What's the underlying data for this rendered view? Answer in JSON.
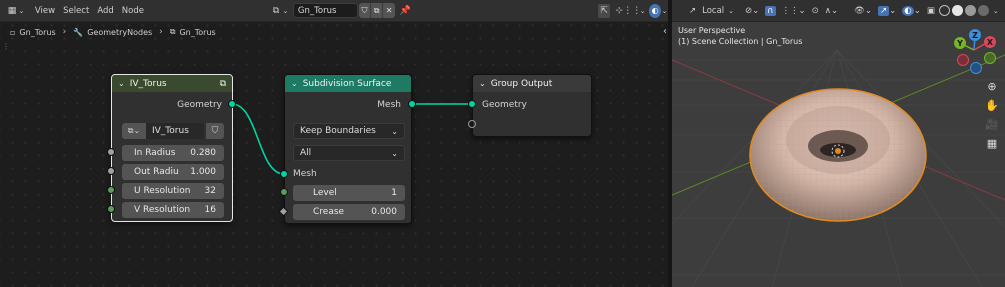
{
  "editor_header": {
    "menu": [
      "View",
      "Select",
      "Add",
      "Node"
    ],
    "node_group_name": "Gn_Torus"
  },
  "breadcrumb": [
    "Gn_Torus",
    "GeometryNodes",
    "Gn_Torus"
  ],
  "nodes": {
    "torus": {
      "title": "IV_Torus",
      "output_label": "Geometry",
      "group_name": "IV_Torus",
      "fields": [
        {
          "label": "In Radius",
          "value": "0.280"
        },
        {
          "label": "Out Radiu",
          "value": "1.000"
        },
        {
          "label": "U Resolution",
          "value": "32"
        },
        {
          "label": "V Resolution",
          "value": "16"
        }
      ],
      "header_color": "#3a4a2e"
    },
    "subdivision": {
      "title": "Subdivision Surface",
      "output_label": "Mesh",
      "dropdown1": "Keep Boundaries",
      "dropdown2": "All",
      "input_label": "Mesh",
      "level_label": "Level",
      "level_value": "1",
      "crease_label": "Crease",
      "crease_value": "0.000",
      "header_color": "#1f7a63"
    },
    "output": {
      "title": "Group Output",
      "input_label": "Geometry",
      "header_color": "#3a3a3a"
    }
  },
  "viewport": {
    "orientation": "Local",
    "info_line1": "User Perspective",
    "info_line2": "(1) Scene Collection | Gn_Torus",
    "gizmo": {
      "z": "Z",
      "y": "Y",
      "x": "X"
    }
  },
  "colors": {
    "geometry_socket": "#00d6a3",
    "selection_outline": "#e38a1e",
    "x_axis": "#d8485a",
    "y_axis": "#73b526",
    "z_axis": "#3d8de0"
  }
}
